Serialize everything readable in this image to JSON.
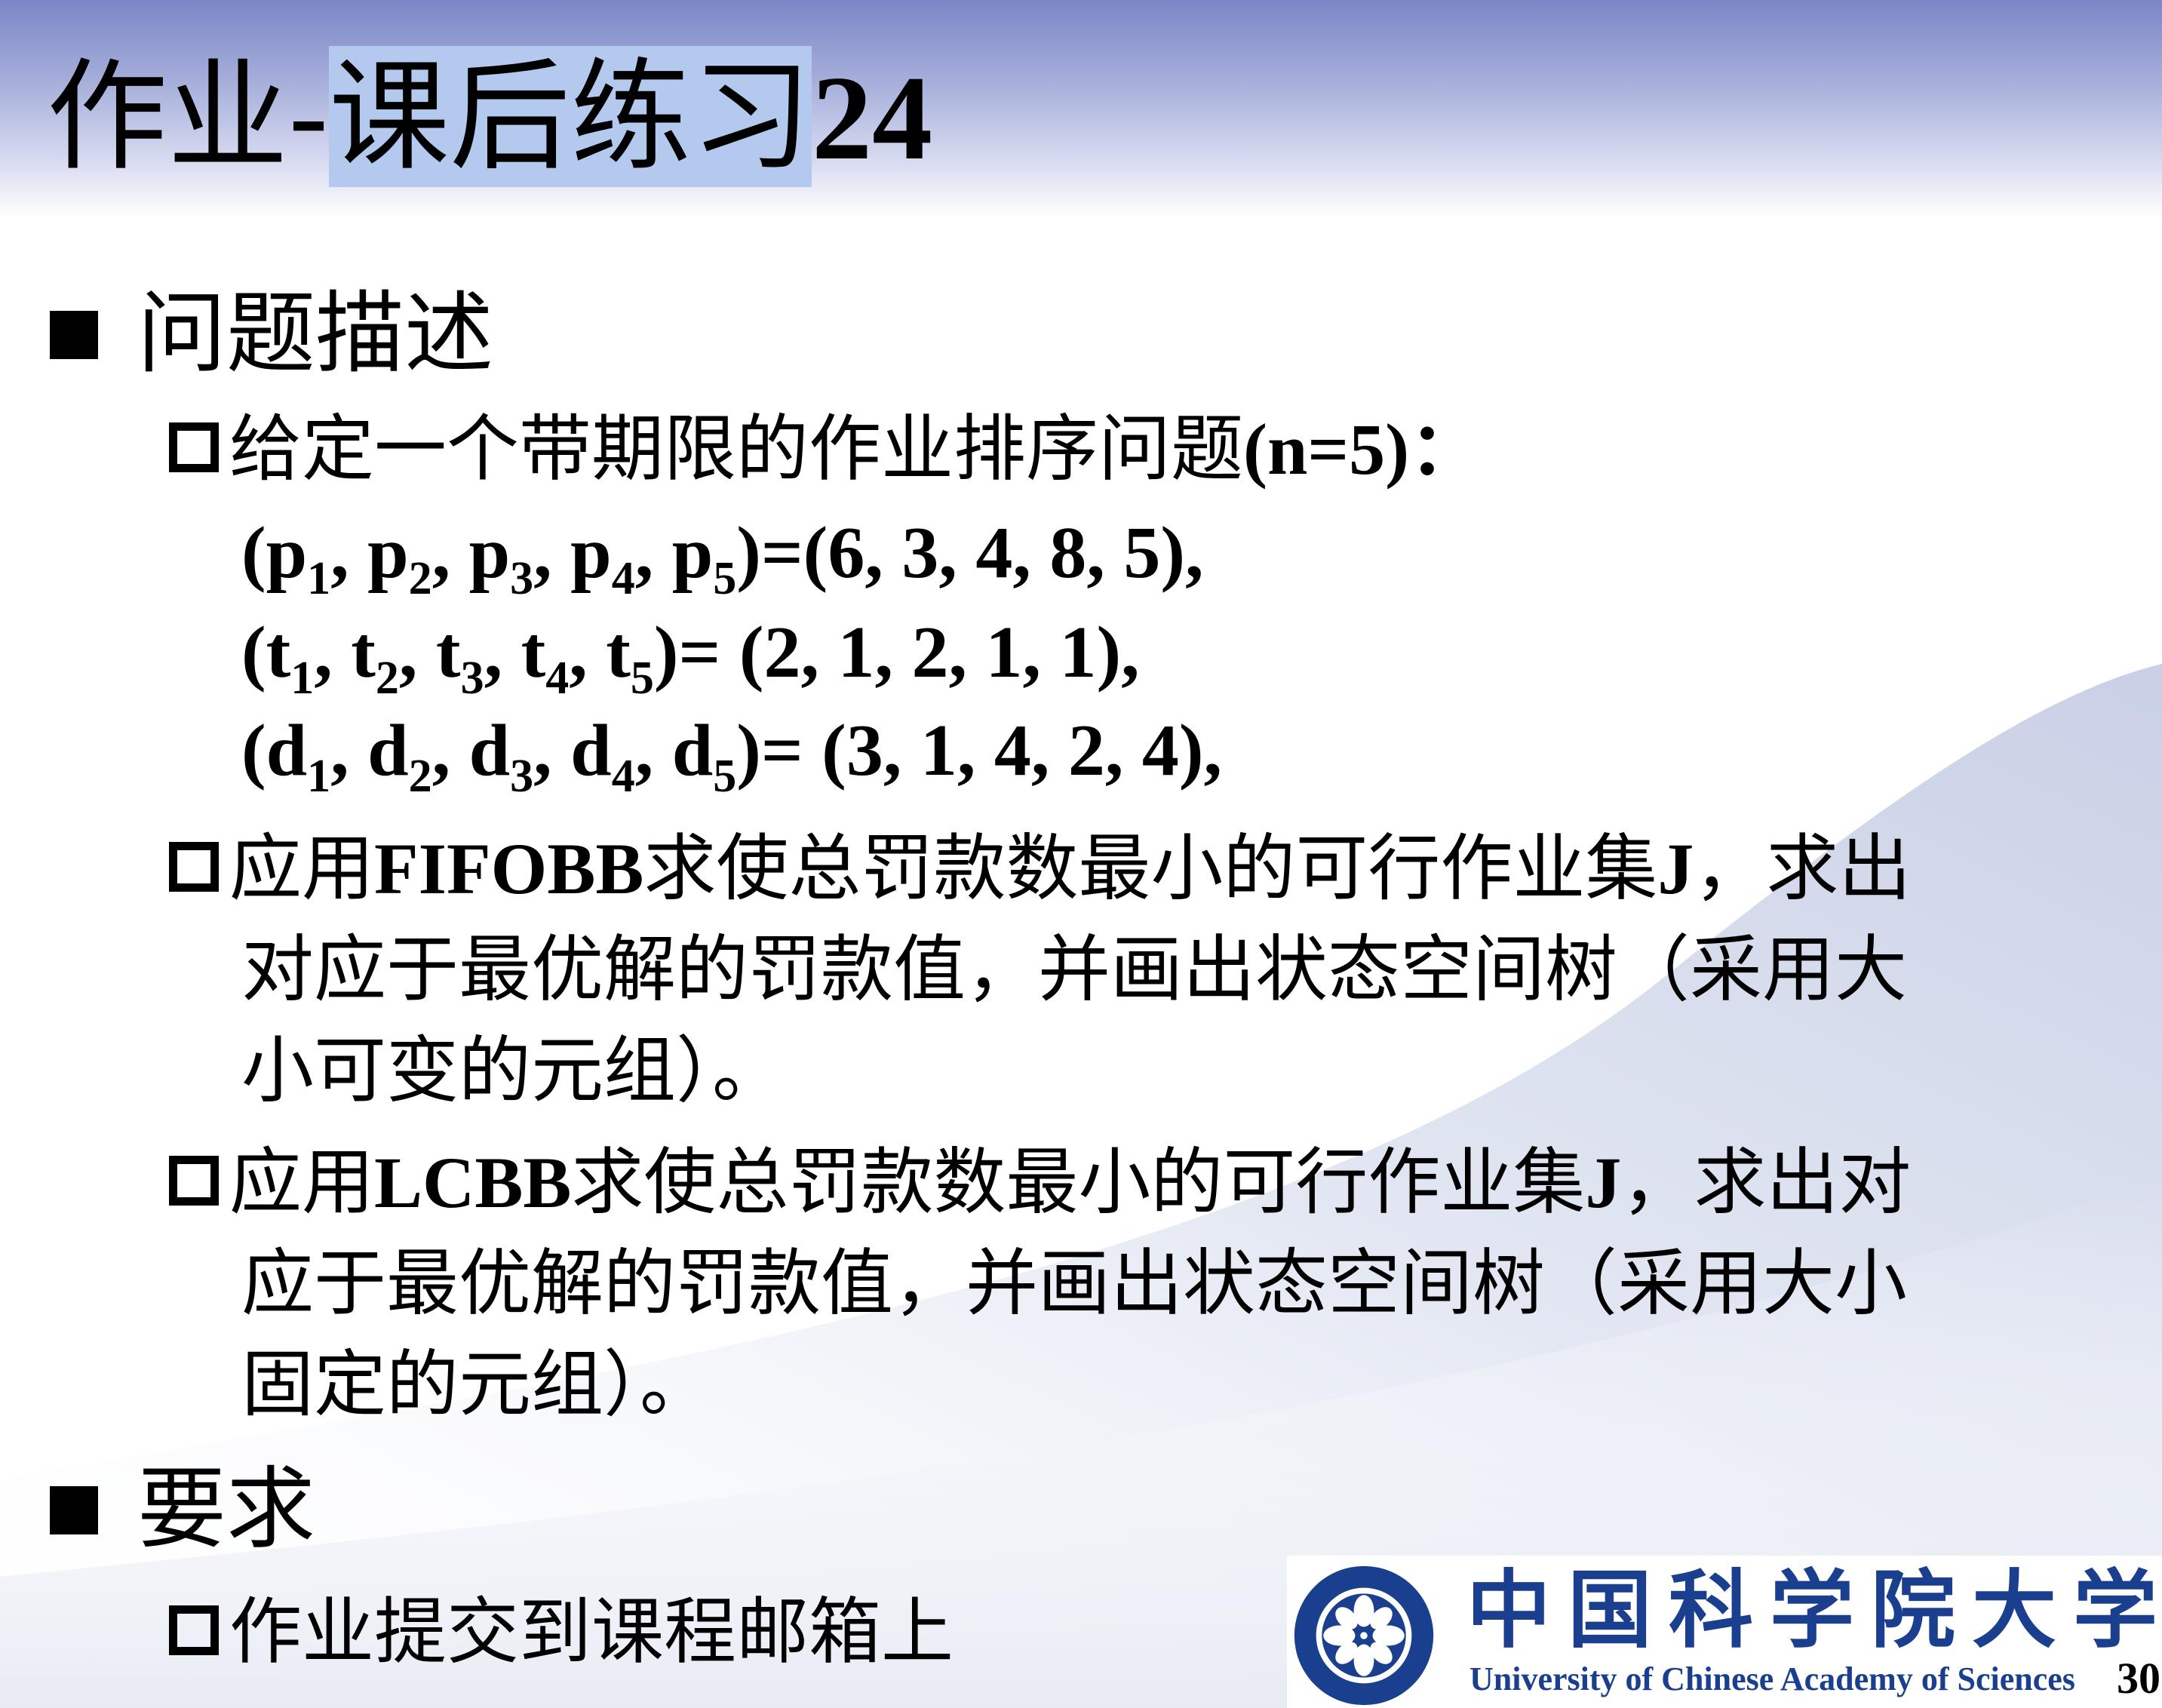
{
  "title": {
    "prefix": "作业-",
    "highlighted": "课后练习",
    "number": "24"
  },
  "section1": {
    "heading": "问题描述",
    "item1": {
      "text_cn": "给定一个带期限的作业排序问题",
      "text_tail": "(n=5)：",
      "p_line": [
        "(p",
        "1",
        ", p",
        "2",
        ", p",
        "3",
        ", p",
        "4",
        ", p",
        "5",
        ")=(6, 3, 4, 8, 5),"
      ],
      "t_line": [
        "(t",
        "1",
        ", t",
        "2",
        ", t",
        "3",
        ", t",
        "4",
        ", t",
        "5",
        ")= (2, 1, 2, 1, 1),"
      ],
      "d_line": [
        "(d",
        "1",
        ", d",
        "2",
        ", d",
        "3",
        ", d",
        "4",
        ", d",
        "5",
        ")= (3, 1, 4, 2, 4),"
      ]
    },
    "item2": {
      "line1_a": "应用",
      "line1_b": "FIFOBB",
      "line1_c": "求使总罚款数最小的可行作业集",
      "line1_d": "J",
      "line1_e": "，求出",
      "line2": "对应于最优解的罚款值，并画出状态空间树（采用大",
      "line3": "小可变的元组）。"
    },
    "item3": {
      "line1_a": "应用",
      "line1_b": "LCBB",
      "line1_c": "求使总罚款数最小的可行作业集",
      "line1_d": "J",
      "line1_e": "，求出对",
      "line2": "应于最优解的罚款值，并画出状态空间树（采用大小",
      "line3": "固定的元组）。"
    }
  },
  "section2": {
    "heading": "要求",
    "item1": "作业提交到课程邮箱上"
  },
  "logo": {
    "name_cn": "中国科学院大学",
    "name_en": "University of Chinese Academy of Sciences"
  },
  "page_number": "30",
  "colors": {
    "title_band_top": "#7b86c6",
    "highlight": "#b4c9ee",
    "logo_blue": "#1b3f8f"
  }
}
